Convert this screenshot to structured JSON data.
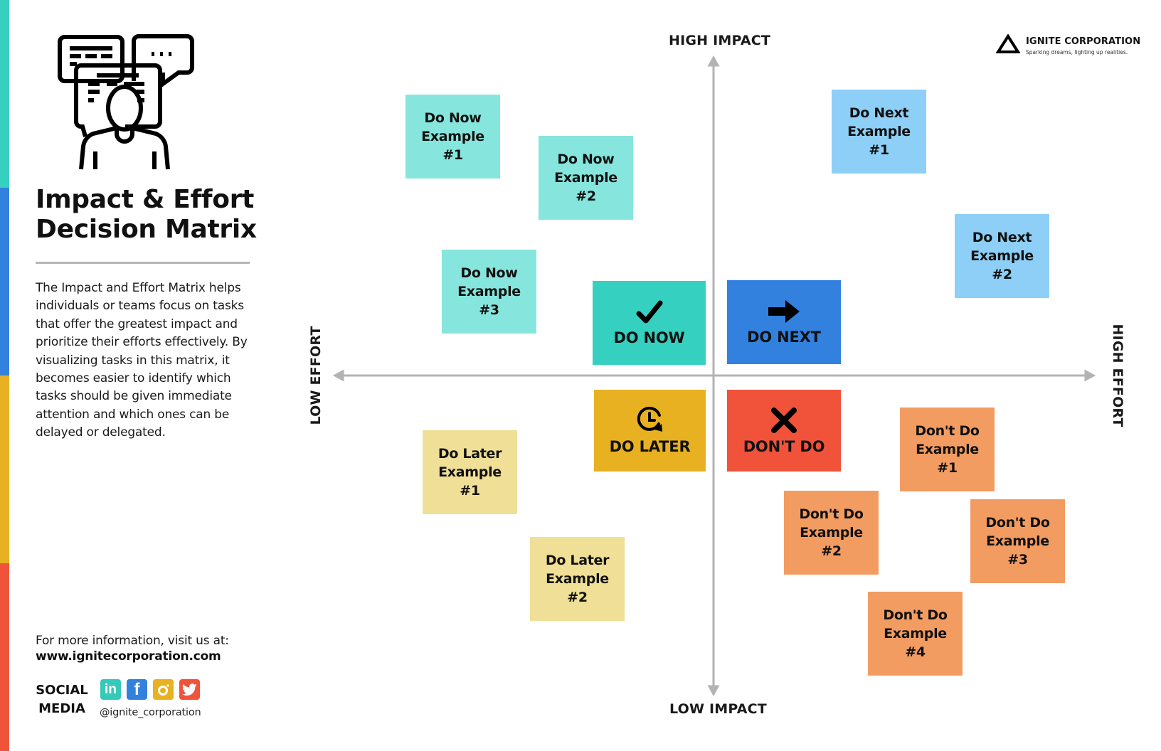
{
  "sidebar": {
    "stripe_colors": [
      "#35d0c0",
      "#3381de",
      "#e8b122",
      "#f0533a"
    ],
    "illustration": "person-with-speech-bubbles-icon",
    "title_line1": "Impact & Effort",
    "title_line2": "Decision Matrix",
    "description": "The Impact and Effort Matrix helps individuals or teams focus on tasks that offer the greatest impact and prioritize their efforts effectively. By visualizing tasks in this matrix, it becomes easier to identify which tasks should be given immediate attention and which ones can be delayed or delegated.",
    "info_text": "For more information, visit us at:",
    "url": "www.ignitecorporation.com",
    "social_label_line1": "SOCIAL",
    "social_label_line2": "MEDIA",
    "social_icons": [
      {
        "name": "linkedin-icon",
        "glyph": "in",
        "color": "#35c9ba"
      },
      {
        "name": "facebook-icon",
        "glyph": "f",
        "color": "#3381de"
      },
      {
        "name": "instagram-icon",
        "glyph": "",
        "color": "#e8b122"
      },
      {
        "name": "twitter-icon",
        "glyph": "",
        "color": "#f0533a"
      }
    ],
    "handle": "@ignite_corporation"
  },
  "logo": {
    "icon": "triangle-icon",
    "name": "IGNITE CORPORATION",
    "tagline": "Sparking dreams, lighting up realities."
  },
  "axes": {
    "top": "HIGH IMPACT",
    "bottom": "LOW IMPACT",
    "left": "LOW EFFORT",
    "right": "HIGH EFFORT",
    "color": "#b3b3b3"
  },
  "quadrants": {
    "do_now": {
      "label": "DO NOW",
      "icon": "checkmark-icon",
      "color": "#35d0c0"
    },
    "do_next": {
      "label": "DO NEXT",
      "icon": "arrow-right-icon",
      "color": "#3381de"
    },
    "do_later": {
      "label": "DO LATER",
      "icon": "clock-icon",
      "color": "#e8b122"
    },
    "dont_do": {
      "label": "DON'T DO",
      "icon": "x-mark-icon",
      "color": "#f0533a"
    }
  },
  "notes": {
    "do_now": {
      "color": "#86e6dd",
      "items": [
        {
          "line1": "Do Now",
          "line2": "Example",
          "line3": "#1"
        },
        {
          "line1": "Do Now",
          "line2": "Example",
          "line3": "#2"
        },
        {
          "line1": "Do Now",
          "line2": "Example",
          "line3": "#3"
        }
      ]
    },
    "do_next": {
      "color": "#8dcff7",
      "items": [
        {
          "line1": "Do Next",
          "line2": "Example",
          "line3": "#1"
        },
        {
          "line1": "Do Next",
          "line2": "Example",
          "line3": "#2"
        }
      ]
    },
    "do_later": {
      "color": "#f0df96",
      "items": [
        {
          "line1": "Do Later",
          "line2": "Example",
          "line3": "#1"
        },
        {
          "line1": "Do Later",
          "line2": "Example",
          "line3": "#2"
        }
      ]
    },
    "dont_do": {
      "color": "#f39c62",
      "items": [
        {
          "line1": "Don't Do",
          "line2": "Example",
          "line3": "#1"
        },
        {
          "line1": "Don't Do",
          "line2": "Example",
          "line3": "#2"
        },
        {
          "line1": "Don't Do",
          "line2": "Example",
          "line3": "#3"
        },
        {
          "line1": "Don't Do",
          "line2": "Example",
          "line3": "#4"
        }
      ]
    }
  }
}
